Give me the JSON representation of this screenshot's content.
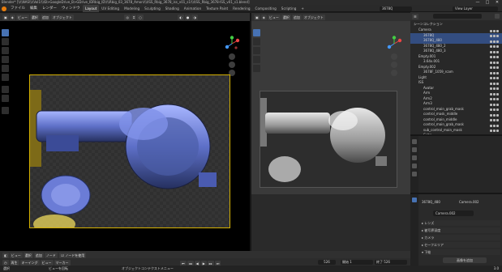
{
  "window": {
    "title": "Blender* [\\\\\\\\NAS\\\\\\\\Vol1\\\\\\\\B>GoogleDrive_B>GDrive_IDRbig_ID\\\\\\\\Rbig_03_3678_Amon\\\\\\\\ISS_Rbig_3678_iss_v01_s1\\\\\\\\ISS_Rbig_3678-ISS_v01_s1.blend]",
    "min": "—",
    "max": "□",
    "close": "✕"
  },
  "menu": [
    "ファイル",
    "編集",
    "レンダー",
    "ウィンドウ",
    "ヘルプ"
  ],
  "workspaces": [
    "Layout",
    "UV Editing",
    "Modeling",
    "Sculpting",
    "Shading",
    "Animation",
    "Texture Paint",
    "Rendering",
    "Compositing",
    "Scripting",
    "+"
  ],
  "scene_field": "3678Q",
  "view_layer": "View Layer",
  "left_viewport": {
    "header": [
      "ビュー",
      "選択",
      "追加",
      "オブジェクト"
    ],
    "view_label": "カメラ・透視投影"
  },
  "right_viewport": {
    "header": [
      "ビュー",
      "選択",
      "追加",
      "オブジェクト"
    ]
  },
  "outliner": {
    "title": "シーンコレクション",
    "rows": [
      {
        "label": "Camera",
        "indent": 1,
        "sel": false
      },
      {
        "label": "3678Q",
        "indent": 2,
        "sel": true
      },
      {
        "label": "3678Q_480",
        "indent": 2,
        "sel": true
      },
      {
        "label": "3678Q_480_2",
        "indent": 2,
        "sel": false
      },
      {
        "label": "3678Q_480_3",
        "indent": 2,
        "sel": false
      },
      {
        "label": "Empty.001",
        "indent": 1,
        "sel": false
      },
      {
        "label": "3.64x.001",
        "indent": 2,
        "sel": false
      },
      {
        "label": "Empty.002",
        "indent": 1,
        "sel": false
      },
      {
        "label": "3678F_1059_rcam",
        "indent": 2,
        "sel": false
      },
      {
        "label": "Light",
        "indent": 1,
        "sel": false
      },
      {
        "label": "ISS",
        "indent": 1,
        "sel": false
      },
      {
        "label": "Avatar",
        "indent": 2,
        "sel": false
      },
      {
        "label": "Arm",
        "indent": 2,
        "sel": false
      },
      {
        "label": "Arm2",
        "indent": 2,
        "sel": false
      },
      {
        "label": "Arm3",
        "indent": 2,
        "sel": false
      },
      {
        "label": "control_main_grab_mask",
        "indent": 2,
        "sel": false
      },
      {
        "label": "control_mask_middle",
        "indent": 2,
        "sel": false
      },
      {
        "label": "control_main_middle",
        "indent": 2,
        "sel": false
      },
      {
        "label": "control_main_grab_mask",
        "indent": 2,
        "sel": false
      },
      {
        "label": "sub_control_main_mask",
        "indent": 2,
        "sel": false
      },
      {
        "label": "Cube",
        "indent": 2,
        "sel": false
      },
      {
        "label": "camera",
        "indent": 1,
        "sel": false
      }
    ]
  },
  "properties": {
    "object_name": "3678Q_480",
    "camera_name": "Camera.002",
    "data_field": "Camera.002",
    "sections": [
      "レンズ",
      "被写界深度",
      "カメラ",
      "セーフエリア",
      "下絵"
    ],
    "add_button": "画像を追加"
  },
  "timeline": {
    "header": [
      "再生",
      "キーイング",
      "ビュー",
      "マーカー"
    ],
    "frame_current": "526",
    "start_label": "開始",
    "start": "1",
    "end_label": "終了",
    "end": "526",
    "node_label": "ノードを使用",
    "node_header": [
      "ビュー",
      "選択",
      "追加",
      "ノード"
    ]
  },
  "status": {
    "left": "選択",
    "mid": "ビューを回転",
    "right": "オブジェクトコンテクストメニュー",
    "version": "3.0"
  },
  "colors": {
    "accent": "#4772b3",
    "selected_row": "#334d80",
    "camera_frame": "#d4b000"
  }
}
